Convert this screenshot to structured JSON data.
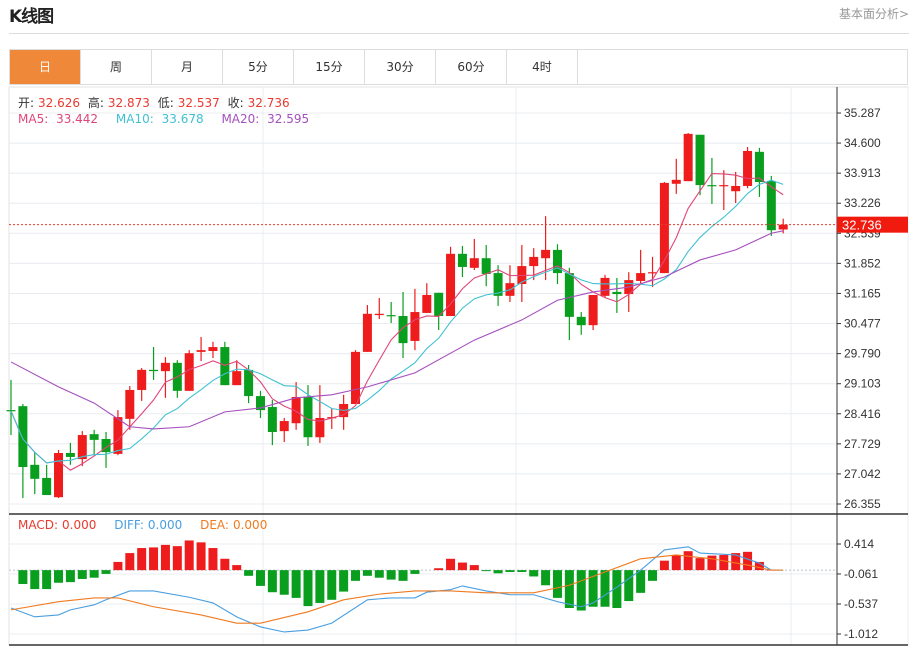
{
  "header": {
    "title": "K线图",
    "link": "基本面分析>"
  },
  "tabs": [
    {
      "label": "日",
      "active": true
    },
    {
      "label": "周"
    },
    {
      "label": "月"
    },
    {
      "label": "5分"
    },
    {
      "label": "15分"
    },
    {
      "label": "30分"
    },
    {
      "label": "60分"
    },
    {
      "label": "4时"
    }
  ],
  "ohlc_info": {
    "open_label": "开:",
    "open": "32.626",
    "high_label": "高:",
    "high": "32.873",
    "low_label": "低:",
    "low": "32.537",
    "close_label": "收:",
    "close": "32.736"
  },
  "ma_info": {
    "ma5_label": "MA5:",
    "ma5": "33.442",
    "ma10_label": "MA10:",
    "ma10": "33.678",
    "ma20_label": "MA20:",
    "ma20": "32.595"
  },
  "macd_info": {
    "macd_label": "MACD:",
    "macd": "0.000",
    "diff_label": "DIFF:",
    "diff": "0.000",
    "dea_label": "DEA:",
    "dea": "0.000"
  },
  "colors": {
    "up": "#ee1c1c",
    "down": "#0a9e1e",
    "ma5": "#e0467a",
    "ma10": "#3fc1d2",
    "ma20": "#a64fbf",
    "diff": "#4a9fe0",
    "dea": "#f07a20",
    "active_tab": "#f0883a"
  },
  "chart_data": [
    {
      "type": "candlestick",
      "ylim": [
        26.355,
        35.287
      ],
      "yticks": [
        "35.287",
        "34.600",
        "33.913",
        "33.226",
        "32.539",
        "31.852",
        "31.165",
        "30.477",
        "29.790",
        "29.103",
        "28.416",
        "27.729",
        "27.042",
        "26.355"
      ],
      "last_price": "32.736",
      "candles": [
        [
          28.5,
          29.19,
          27.93,
          28.48
        ],
        [
          28.59,
          28.64,
          26.49,
          27.2
        ],
        [
          27.25,
          27.54,
          26.58,
          26.93
        ],
        [
          26.95,
          27.25,
          26.56,
          26.56
        ],
        [
          26.51,
          27.59,
          26.49,
          27.52
        ],
        [
          27.52,
          27.75,
          27.25,
          27.43
        ],
        [
          27.38,
          28.02,
          27.22,
          27.93
        ],
        [
          27.95,
          28.05,
          27.47,
          27.82
        ],
        [
          27.84,
          28.0,
          27.18,
          27.54
        ],
        [
          27.5,
          28.5,
          27.47,
          28.34
        ],
        [
          28.3,
          29.05,
          28.05,
          28.96
        ],
        [
          28.96,
          29.46,
          28.71,
          29.42
        ],
        [
          29.42,
          29.94,
          29.19,
          29.39
        ],
        [
          29.39,
          29.71,
          28.78,
          29.58
        ],
        [
          29.58,
          29.64,
          28.78,
          28.94
        ],
        [
          28.94,
          29.87,
          28.94,
          29.8
        ],
        [
          29.83,
          30.17,
          29.62,
          29.87
        ],
        [
          29.85,
          30.06,
          29.69,
          29.94
        ],
        [
          29.94,
          30.06,
          29.07,
          29.07
        ],
        [
          29.07,
          29.64,
          29.07,
          29.39
        ],
        [
          29.42,
          29.53,
          28.66,
          28.82
        ],
        [
          28.82,
          28.94,
          28.32,
          28.5
        ],
        [
          28.57,
          28.73,
          27.7,
          28.0
        ],
        [
          28.02,
          28.32,
          27.77,
          28.25
        ],
        [
          28.2,
          29.14,
          28.05,
          28.8
        ],
        [
          28.8,
          29.07,
          27.68,
          27.88
        ],
        [
          27.88,
          29.07,
          27.75,
          28.32
        ],
        [
          28.32,
          28.53,
          28.07,
          28.34
        ],
        [
          28.34,
          28.85,
          28.05,
          28.64
        ],
        [
          28.64,
          29.87,
          28.64,
          29.83
        ],
        [
          29.83,
          30.9,
          29.83,
          30.7
        ],
        [
          30.67,
          31.06,
          30.58,
          30.7
        ],
        [
          30.67,
          30.97,
          30.49,
          30.65
        ],
        [
          30.65,
          31.2,
          29.69,
          30.03
        ],
        [
          30.08,
          31.27,
          29.87,
          30.74
        ],
        [
          30.72,
          31.4,
          30.72,
          31.13
        ],
        [
          31.18,
          31.18,
          30.33,
          30.65
        ],
        [
          30.65,
          32.23,
          30.65,
          32.07
        ],
        [
          32.07,
          32.25,
          31.54,
          31.77
        ],
        [
          31.75,
          32.41,
          31.7,
          31.97
        ],
        [
          31.97,
          32.27,
          31.33,
          31.61
        ],
        [
          31.63,
          31.81,
          30.88,
          31.11
        ],
        [
          31.11,
          31.81,
          30.97,
          31.4
        ],
        [
          31.38,
          32.27,
          30.97,
          31.79
        ],
        [
          31.79,
          32.2,
          31.47,
          32.0
        ],
        [
          31.97,
          32.93,
          31.47,
          32.16
        ],
        [
          32.16,
          32.29,
          31.38,
          31.63
        ],
        [
          31.63,
          31.75,
          30.1,
          30.63
        ],
        [
          30.63,
          30.74,
          30.22,
          30.44
        ],
        [
          30.44,
          31.13,
          30.33,
          31.13
        ],
        [
          31.11,
          31.59,
          31.06,
          31.52
        ],
        [
          31.2,
          31.52,
          30.72,
          31.15
        ],
        [
          31.15,
          31.65,
          30.74,
          31.47
        ],
        [
          31.45,
          32.16,
          31.4,
          31.63
        ],
        [
          31.63,
          32.0,
          31.31,
          31.65
        ],
        [
          31.63,
          33.71,
          31.63,
          33.69
        ],
        [
          33.67,
          34.24,
          33.44,
          33.76
        ],
        [
          33.73,
          34.83,
          33.73,
          34.81
        ],
        [
          34.79,
          34.79,
          33.41,
          33.64
        ],
        [
          33.64,
          34.26,
          33.21,
          33.62
        ],
        [
          33.62,
          33.98,
          33.07,
          33.64
        ],
        [
          33.5,
          33.94,
          33.23,
          33.62
        ],
        [
          33.62,
          34.51,
          33.57,
          34.42
        ],
        [
          34.4,
          34.49,
          33.37,
          33.71
        ],
        [
          33.73,
          33.85,
          32.48,
          32.61
        ],
        [
          32.626,
          32.873,
          32.537,
          32.736
        ]
      ],
      "ma20_points": [
        [
          0,
          29.6
        ],
        [
          4,
          29.03
        ],
        [
          7,
          28.66
        ],
        [
          10,
          28.12
        ],
        [
          12,
          28.07
        ],
        [
          15,
          28.12
        ],
        [
          18,
          28.46
        ],
        [
          21,
          28.55
        ],
        [
          24,
          28.78
        ],
        [
          27,
          28.85
        ],
        [
          30,
          29.03
        ],
        [
          34,
          29.35
        ],
        [
          39,
          30.1
        ],
        [
          43,
          30.56
        ],
        [
          46,
          31.01
        ],
        [
          49,
          31.2
        ],
        [
          52,
          31.31
        ],
        [
          55,
          31.54
        ],
        [
          58,
          31.93
        ],
        [
          61,
          32.16
        ],
        [
          64,
          32.54
        ],
        [
          65,
          32.595
        ]
      ]
    },
    {
      "type": "macd",
      "ylim": [
        -1.012,
        0.414
      ],
      "yticks": [
        "0.414",
        "-0.061",
        "-0.537",
        "-1.012"
      ],
      "histogram": [
        0,
        -0.22,
        -0.3,
        -0.3,
        -0.2,
        -0.19,
        -0.14,
        -0.12,
        -0.06,
        0.13,
        0.27,
        0.35,
        0.36,
        0.4,
        0.38,
        0.47,
        0.44,
        0.35,
        0.18,
        0.08,
        -0.09,
        -0.25,
        -0.35,
        -0.39,
        -0.44,
        -0.57,
        -0.52,
        -0.47,
        -0.34,
        -0.17,
        -0.09,
        -0.12,
        -0.15,
        -0.17,
        -0.06,
        0.0,
        0.03,
        0.18,
        0.12,
        0.08,
        -0.01,
        -0.05,
        -0.03,
        -0.03,
        -0.1,
        -0.24,
        -0.44,
        -0.6,
        -0.64,
        -0.58,
        -0.58,
        -0.6,
        -0.49,
        -0.36,
        -0.17,
        0.15,
        0.24,
        0.3,
        0.19,
        0.23,
        0.24,
        0.27,
        0.29,
        0.13,
        0.01,
        0
      ],
      "diff_points": [
        [
          0,
          -0.6
        ],
        [
          2,
          -0.74
        ],
        [
          4,
          -0.71
        ],
        [
          5,
          -0.63
        ],
        [
          7,
          -0.55
        ],
        [
          8,
          -0.47
        ],
        [
          10,
          -0.33
        ],
        [
          12,
          -0.33
        ],
        [
          15,
          -0.43
        ],
        [
          17,
          -0.52
        ],
        [
          19,
          -0.74
        ],
        [
          21,
          -0.9
        ],
        [
          23,
          -0.98
        ],
        [
          25,
          -0.95
        ],
        [
          27,
          -0.84
        ],
        [
          30,
          -0.47
        ],
        [
          32,
          -0.44
        ],
        [
          34,
          -0.44
        ],
        [
          35,
          -0.35
        ],
        [
          37,
          -0.31
        ],
        [
          38,
          -0.25
        ],
        [
          40,
          -0.33
        ],
        [
          42,
          -0.39
        ],
        [
          44,
          -0.39
        ],
        [
          46,
          -0.5
        ],
        [
          48,
          -0.58
        ],
        [
          49,
          -0.52
        ],
        [
          51,
          -0.27
        ],
        [
          53,
          0.0
        ],
        [
          55,
          0.32
        ],
        [
          57,
          0.37
        ],
        [
          58,
          0.27
        ],
        [
          61,
          0.24
        ],
        [
          63,
          0.11
        ],
        [
          64,
          0.0
        ],
        [
          65,
          0.0
        ]
      ],
      "dea_points": [
        [
          0,
          -0.63
        ],
        [
          4,
          -0.5
        ],
        [
          7,
          -0.44
        ],
        [
          9,
          -0.44
        ],
        [
          12,
          -0.58
        ],
        [
          16,
          -0.71
        ],
        [
          19,
          -0.84
        ],
        [
          21,
          -0.84
        ],
        [
          25,
          -0.66
        ],
        [
          28,
          -0.47
        ],
        [
          31,
          -0.38
        ],
        [
          34,
          -0.33
        ],
        [
          37,
          -0.33
        ],
        [
          40,
          -0.36
        ],
        [
          44,
          -0.36
        ],
        [
          47,
          -0.24
        ],
        [
          50,
          -0.03
        ],
        [
          53,
          0.18
        ],
        [
          56,
          0.24
        ],
        [
          59,
          0.18
        ],
        [
          62,
          0.08
        ],
        [
          64,
          0.0
        ],
        [
          65,
          0.0
        ]
      ]
    }
  ]
}
